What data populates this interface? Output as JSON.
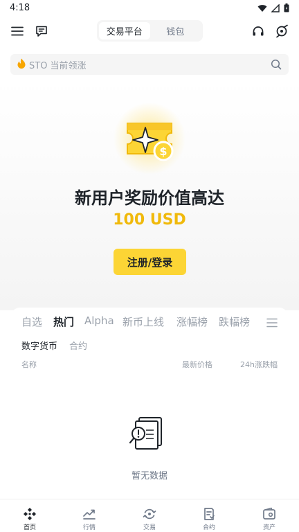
{
  "status_bar": {
    "time": "4:18"
  },
  "header": {
    "segments": [
      {
        "label": "交易平台",
        "active": true
      },
      {
        "label": "钱包",
        "active": false
      }
    ]
  },
  "search": {
    "placeholder": "STO 当前领涨"
  },
  "hero": {
    "title": "新用户奖励价值高达",
    "amount": "100 USD",
    "cta_label": "注册/登录"
  },
  "market": {
    "tabs": [
      "自选",
      "热门",
      "Alpha",
      "新币上线",
      "涨幅榜",
      "跌幅榜"
    ],
    "active_tab": "热门",
    "subtabs": [
      "数字货币",
      "合约"
    ],
    "active_subtab": "数字货币",
    "columns": {
      "name": "名称",
      "price": "最新价格",
      "change": "24h涨跌幅"
    },
    "empty_text": "暂无数据"
  },
  "bottom_nav": [
    {
      "label": "首页",
      "icon": "home-icon",
      "active": true
    },
    {
      "label": "行情",
      "icon": "markets-icon",
      "active": false
    },
    {
      "label": "交易",
      "icon": "trade-icon",
      "active": false
    },
    {
      "label": "合约",
      "icon": "futures-icon",
      "active": false
    },
    {
      "label": "资产",
      "icon": "wallet-icon",
      "active": false
    }
  ],
  "colors": {
    "accent": "#fcd535",
    "amount": "#f0b90b",
    "text": "#1e2329",
    "muted": "#9aa1ab"
  }
}
